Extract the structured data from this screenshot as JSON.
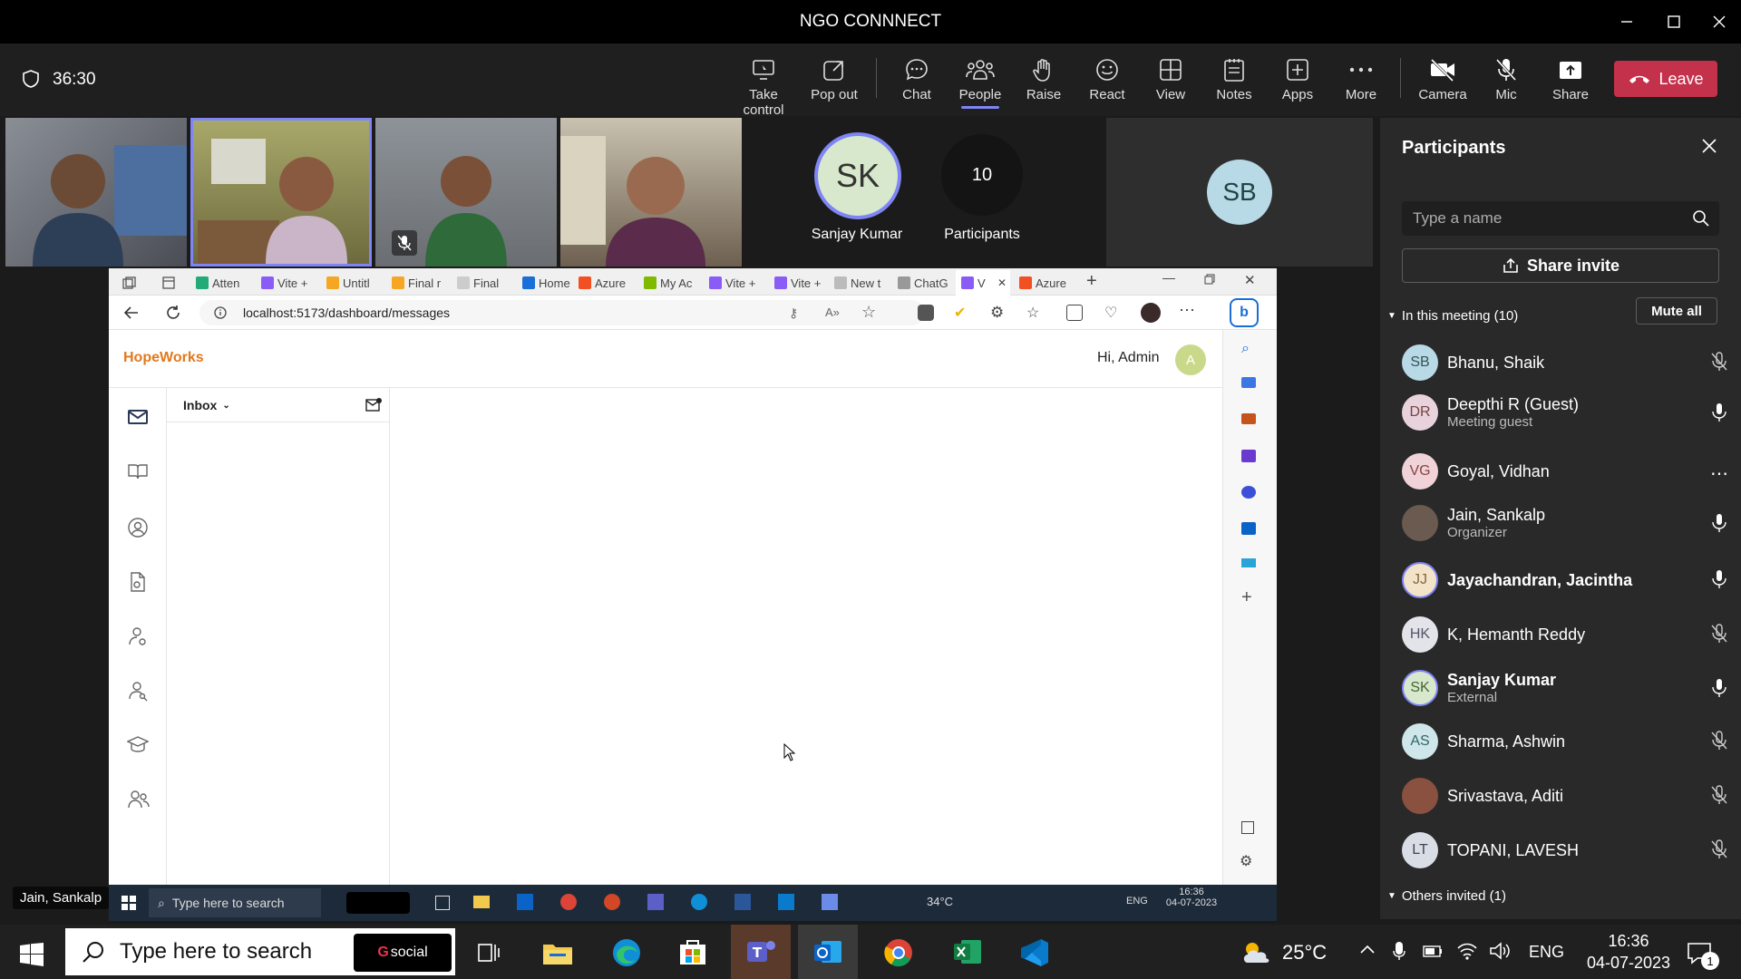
{
  "window": {
    "title": "NGO CONNNECT"
  },
  "meeting": {
    "timer": "36:30",
    "toolbar": [
      {
        "label": "Take control",
        "icon": "take-control-icon"
      },
      {
        "label": "Pop out",
        "icon": "pop-out-icon"
      },
      {
        "label": "Chat",
        "icon": "chat-icon"
      },
      {
        "label": "People",
        "icon": "people-icon"
      },
      {
        "label": "Raise",
        "icon": "raise-hand-icon"
      },
      {
        "label": "React",
        "icon": "react-icon"
      },
      {
        "label": "View",
        "icon": "view-icon"
      },
      {
        "label": "Notes",
        "icon": "notes-icon"
      },
      {
        "label": "Apps",
        "icon": "apps-icon"
      },
      {
        "label": "More",
        "icon": "more-icon"
      },
      {
        "label": "Camera",
        "icon": "camera-off-icon"
      },
      {
        "label": "Mic",
        "icon": "mic-off-icon"
      },
      {
        "label": "Share",
        "icon": "share-icon"
      }
    ],
    "leave_label": "Leave",
    "tiles": {
      "sk_initials": "SK",
      "sk_name": "Sanjay Kumar",
      "count": "10",
      "count_label": "Participants",
      "sb_initials": "SB"
    },
    "speaker_name": "Jain, Sankalp"
  },
  "browser": {
    "tabs": [
      "Atten",
      "Vite +",
      "Untitl",
      "Final r",
      "Final",
      "Home",
      "Azure",
      "My Ac",
      "Vite +",
      "Vite +",
      "New t",
      "ChatG",
      "V",
      "Azure"
    ],
    "url": "localhost:5173/dashboard/messages",
    "app": {
      "brand": "HopeWorks",
      "greeting": "Hi, Admin",
      "avatar": "A",
      "inbox_label": "Inbox"
    },
    "taskbar": {
      "search": "Type here to search",
      "weather": "34°C",
      "lang": "ENG",
      "time": "16:36",
      "date": "04-07-2023"
    }
  },
  "panel": {
    "title": "Participants",
    "search_placeholder": "Type a name",
    "share_invite": "Share invite",
    "in_meeting": "In this meeting (10)",
    "mute_all": "Mute all",
    "others_invited": "Others invited (1)",
    "participants": [
      {
        "initials": "SB",
        "name": "Bhanu, Shaik",
        "sub": "",
        "color": "#b8d9e6",
        "mic": "off"
      },
      {
        "initials": "DR",
        "name": "Deepthi R (Guest)",
        "sub": "Meeting guest",
        "color": "#e8d3dc",
        "mic": "on"
      },
      {
        "initials": "VG",
        "name": "Goyal, Vidhan",
        "sub": "",
        "color": "#f0d3d8",
        "mic": "more"
      },
      {
        "initials": "",
        "name": "Jain, Sankalp",
        "sub": "Organizer",
        "color": "#6a5a50",
        "mic": "on"
      },
      {
        "initials": "JJ",
        "name": "Jayachandran, Jacintha",
        "sub": "",
        "color": "#f3e3c8",
        "mic": "on"
      },
      {
        "initials": "HK",
        "name": "K, Hemanth Reddy",
        "sub": "",
        "color": "#e3e3ea",
        "mic": "off"
      },
      {
        "initials": "SK",
        "name": "Sanjay Kumar",
        "sub": "External",
        "color": "#d8e8cc",
        "mic": "on"
      },
      {
        "initials": "AS",
        "name": "Sharma, Ashwin",
        "sub": "",
        "color": "#cfe6ea",
        "mic": "off"
      },
      {
        "initials": "",
        "name": "Srivastava, Aditi",
        "sub": "",
        "color": "#8a5040",
        "mic": "off"
      },
      {
        "initials": "LT",
        "name": "TOPANI, LAVESH",
        "sub": "",
        "color": "#d9dde6",
        "mic": "off"
      }
    ]
  },
  "taskbar": {
    "search": "Type here to search",
    "badge": "social",
    "weather": "25°C",
    "lang": "ENG",
    "time": "16:36",
    "date": "04-07-2023",
    "notifications": "1"
  }
}
